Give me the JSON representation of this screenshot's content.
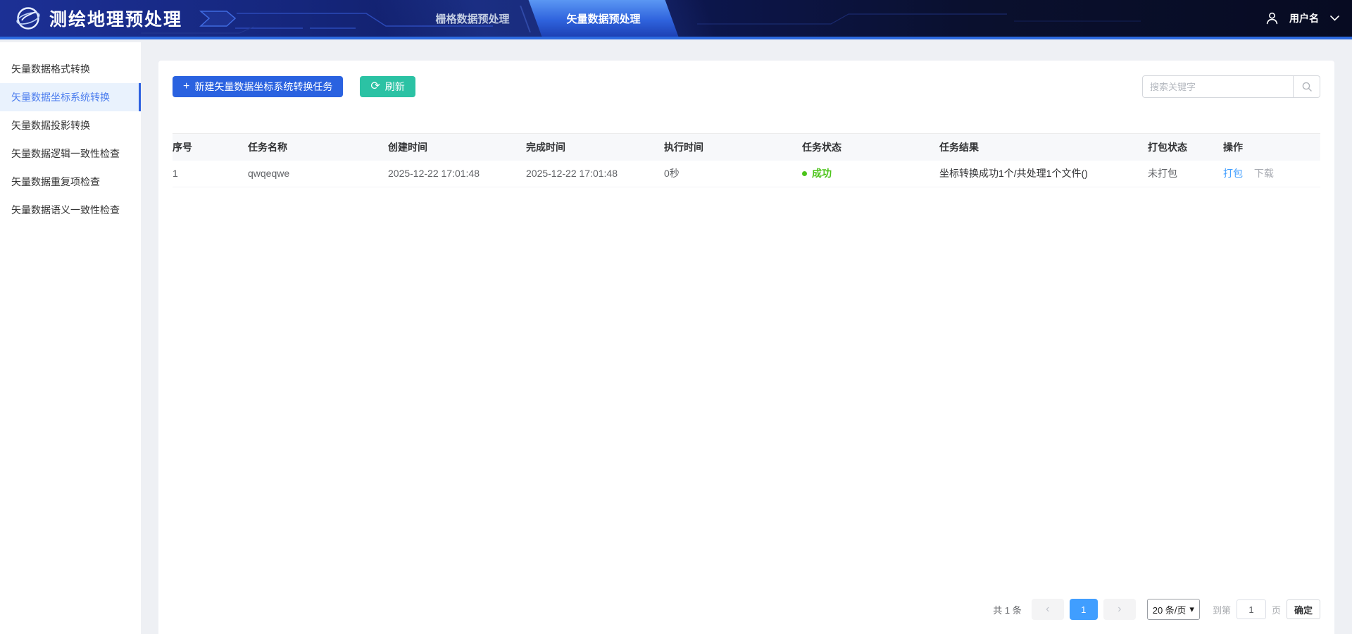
{
  "header": {
    "app_title": "测绘地理预处理",
    "tabs": [
      {
        "label": "栅格数据预处理",
        "active": false
      },
      {
        "label": "矢量数据预处理",
        "active": true
      }
    ],
    "user": {
      "name": "用户名"
    }
  },
  "sidebar": {
    "items": [
      {
        "label": "矢量数据格式转换",
        "active": false
      },
      {
        "label": "矢量数据坐标系统转换",
        "active": true
      },
      {
        "label": "矢量数据投影转换",
        "active": false
      },
      {
        "label": "矢量数据逻辑一致性检查",
        "active": false
      },
      {
        "label": "矢量数据重复项检查",
        "active": false
      },
      {
        "label": "矢量数据语义一致性检查",
        "active": false
      }
    ]
  },
  "toolbar": {
    "new_task_label": "新建矢量数据坐标系统转换任务",
    "refresh_label": "刷新",
    "search_placeholder": "搜索关键字"
  },
  "table": {
    "columns": [
      "序号",
      "任务名称",
      "创建时间",
      "完成时间",
      "执行时间",
      "任务状态",
      "任务结果",
      "打包状态",
      "操作"
    ],
    "rows": [
      {
        "index": "1",
        "task_name": "qwqeqwe",
        "created_at": "2025-12-22 17:01:48",
        "finished_at": "2025-12-22 17:01:48",
        "duration": "0秒",
        "status": "成功",
        "result": "坐标转换成功1个/共处理1个文件()",
        "package_status": "未打包",
        "actions": {
          "package": "打包",
          "download": "下载"
        }
      }
    ]
  },
  "pagination": {
    "total_label": "共 1 条",
    "current_page": "1",
    "page_size_label": "20 条/页",
    "goto_prefix": "到第",
    "goto_value": "1",
    "goto_suffix": "页",
    "confirm_label": "确定"
  },
  "icons": {
    "plus": "+",
    "refresh": "⟳",
    "prev": "‹",
    "next": "›",
    "caret_down": "▾"
  },
  "colors": {
    "header_accent": "#2c6ae0",
    "primary_button": "#2a62e0",
    "refresh_button": "#2bc2a4",
    "success": "#4cc41a",
    "link": "#409eff",
    "pager_active": "#409eff",
    "sidebar_active_text": "#4a7cee"
  }
}
